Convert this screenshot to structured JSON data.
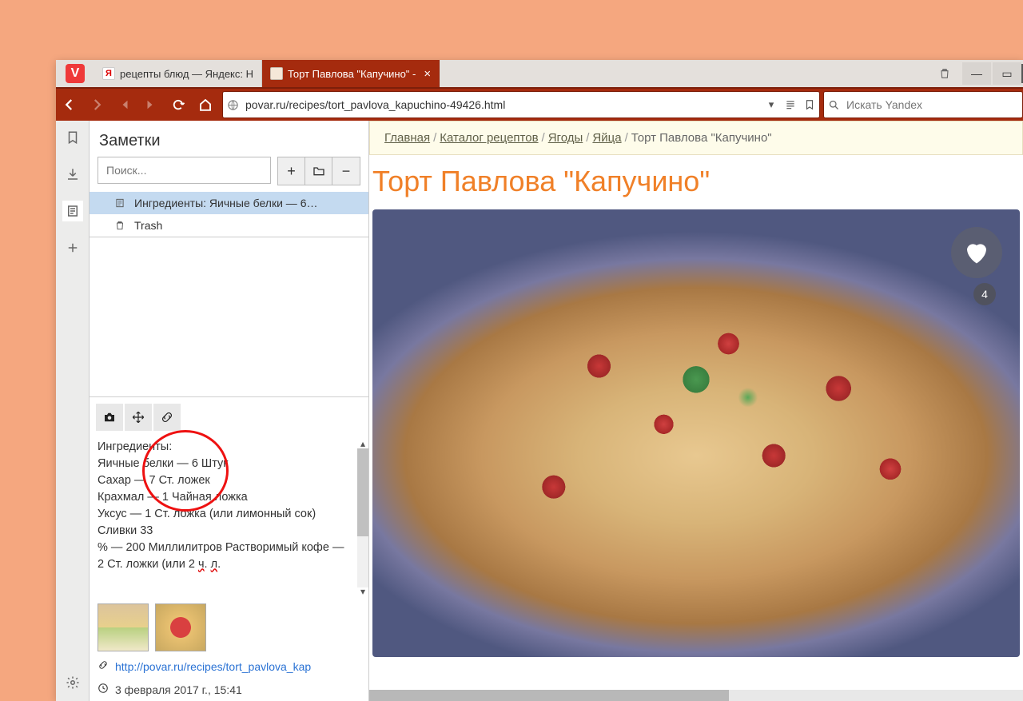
{
  "window": {
    "app_char": "V",
    "tabs": [
      {
        "favicon_bg": "#fff",
        "favicon_char": "Я",
        "favicon_color": "#d00",
        "title": "рецепты блюд — Яндекс: Н",
        "active": false
      },
      {
        "favicon_bg": "#f5e8d8",
        "favicon_char": "",
        "favicon_color": "#333",
        "title": "Торт Павлова \"Капучино\" -",
        "active": true
      }
    ]
  },
  "nav": {
    "url": "povar.ru/recipes/tort_pavlova_kapuchino-49426.html",
    "search_placeholder": "Искать Yandex"
  },
  "notes": {
    "heading": "Заметки",
    "search_placeholder": "Поиск...",
    "items": [
      {
        "title": "Ингредиенты: Яичные белки — 6…",
        "icon": "note",
        "selected": true,
        "indent": true
      },
      {
        "title": "Trash",
        "icon": "trash",
        "selected": false,
        "indent": true
      }
    ],
    "body_lines": [
      "Ингредиенты:",
      "Яичные белки — 6 Штук",
      "Сахар — 7 Ст. ложек",
      "Крахмал — 1 Чайная ложка",
      "Уксус — 1 Ст. ложка (или лимонный сок) Сливки 33",
      "% — 200 Миллилитров Растворимый кофе — 2 Ст. ложки (или 2 ч. л."
    ],
    "link": "http://povar.ru/recipes/tort_pavlova_kaр",
    "date": "3 февраля 2017 г., 15:41"
  },
  "page": {
    "breadcrumb": [
      {
        "label": "Главная",
        "link": true
      },
      {
        "label": "Каталог рецептов",
        "link": true
      },
      {
        "label": "Ягоды",
        "link": true
      },
      {
        "label": "Яйца",
        "link": true
      },
      {
        "label": "Торт Павлова \"Капучино\"",
        "link": false
      }
    ],
    "title": "Торт Павлова \"Капучино\"",
    "fav_count": "4"
  }
}
